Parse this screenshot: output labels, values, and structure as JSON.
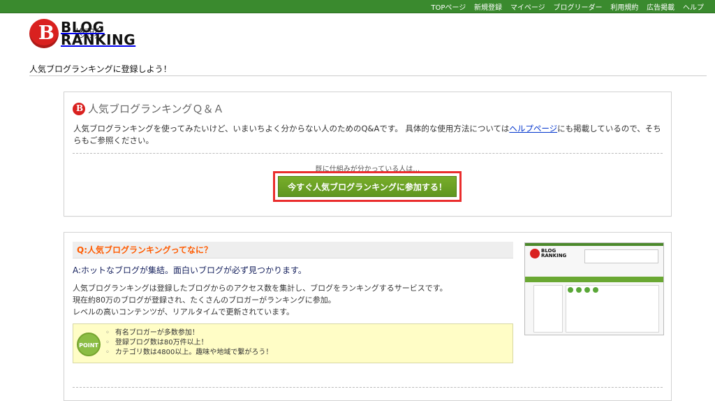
{
  "topnav": [
    "TOPページ",
    "新規登録",
    "マイページ",
    "ブログリーダー",
    "利用規約",
    "広告掲載",
    "ヘルプ"
  ],
  "header": {
    "logo_blog": "BLOG",
    "logo_ranking": "RANKING",
    "logo_jp": "人気ブログランキング"
  },
  "page": {
    "title": "人気ブログランキングに登録しよう！"
  },
  "qa": {
    "title": "人気ブログランキングＱ＆Ａ",
    "intro_before": "人気ブログランキングを使ってみたいけど、いまいちよく分からない人のためのQ&Aです。 具体的な使用方法については",
    "help_link": "ヘルプページ",
    "intro_after": "にも掲載しているので、そちらもご参照ください。",
    "hint": "既に仕組みが分かっている人は…",
    "cta": "今すぐ人気ブログランキングに参加する！"
  },
  "question": {
    "title": "Q:人気ブログランキングってなに？",
    "answer": "A:ホットなブログが集結。面白いブログが必ず見つかります。",
    "about": [
      "人気ブログランキングは登録したブログからのアクセス数を集計し、ブログをランキングするサービスです。",
      "現在約80万のブログが登録され、たくさんのブロガーがランキングに参加。",
      "レベルの高いコンテンツが、リアルタイムで更新されています。"
    ],
    "point_label": "POINT",
    "points": [
      "有名ブロガーが多数参加！",
      "登録ブログ数は80万件以上！",
      "カテゴリ数は4800以上。趣味や地域で繋がろう！"
    ]
  }
}
